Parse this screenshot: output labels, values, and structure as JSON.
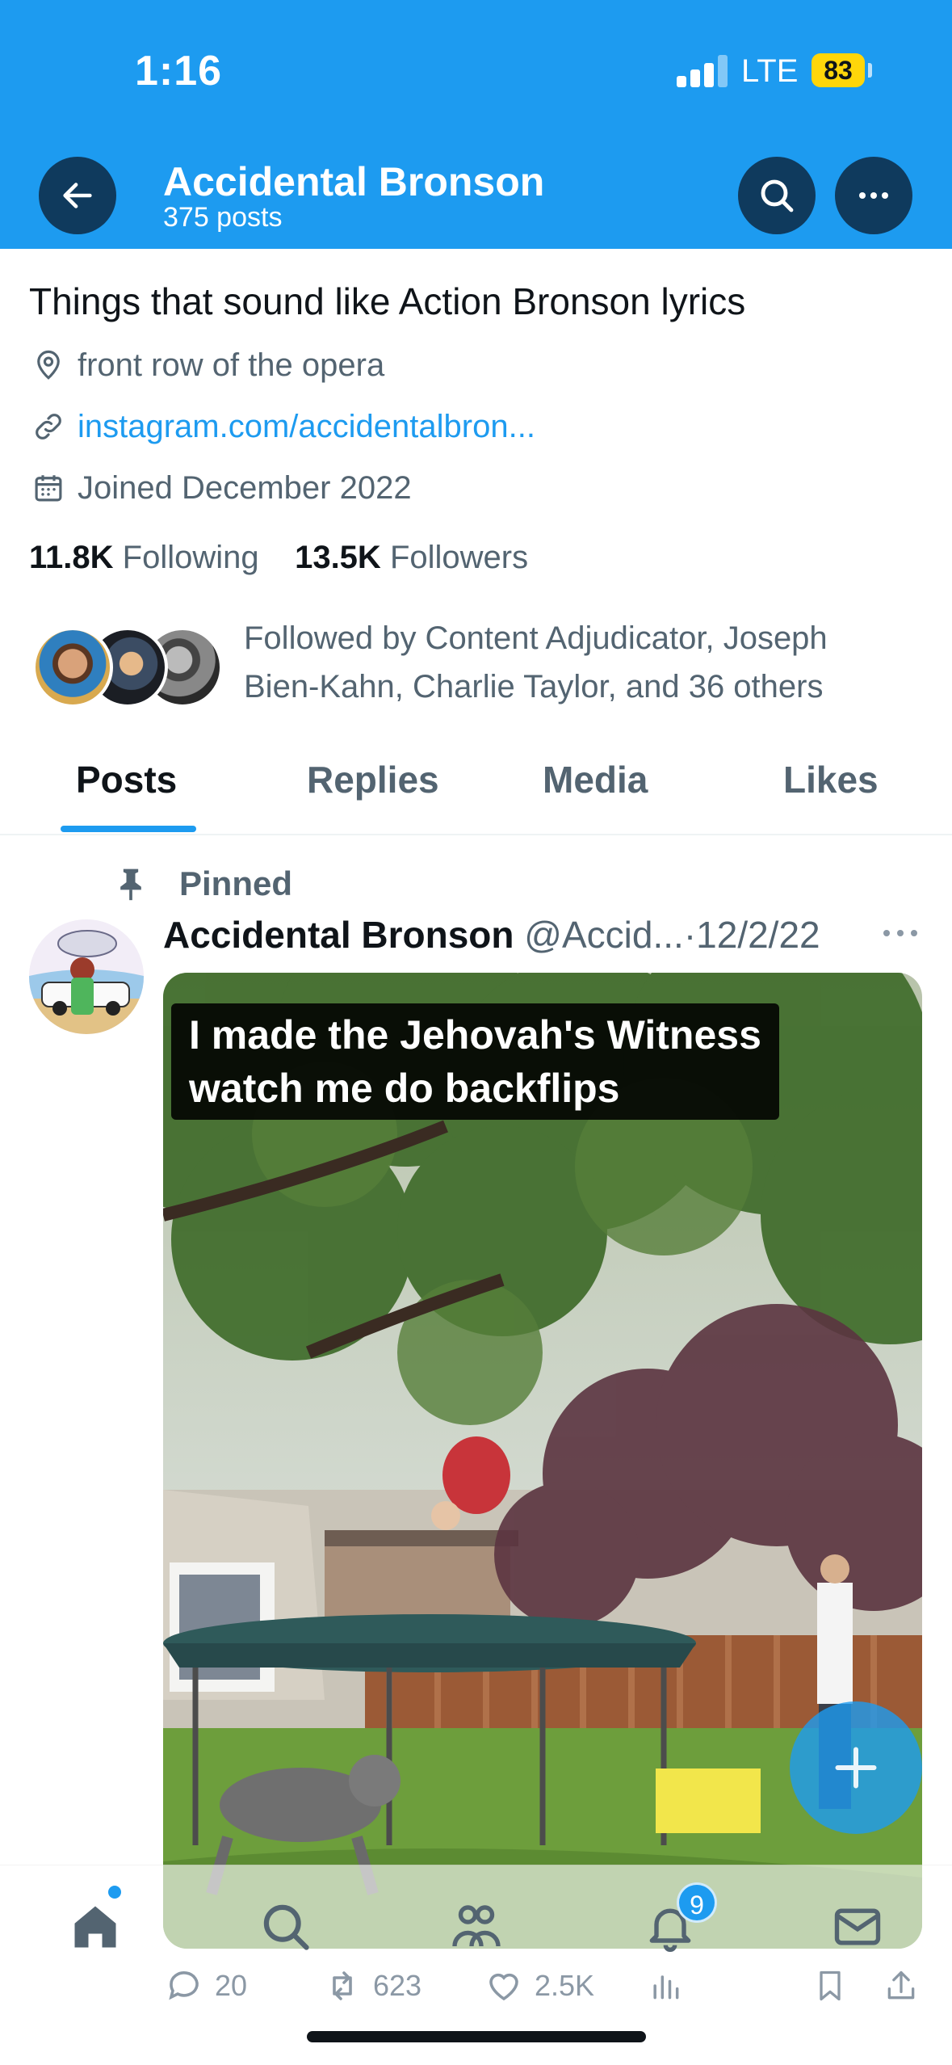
{
  "status_bar": {
    "time": "1:16",
    "network": "LTE",
    "battery": "83"
  },
  "header": {
    "title": "Accidental Bronson",
    "subtitle": "375 posts"
  },
  "profile": {
    "bio": "Things that sound like Action Bronson lyrics",
    "location": "front row of the opera",
    "link": "instagram.com/accidentalbron...",
    "joined": "Joined December 2022",
    "following_count": "11.8K",
    "following_label": "Following",
    "followers_count": "13.5K",
    "followers_label": "Followers",
    "followed_by": "Followed by Content Adjudicator, Joseph Bien-Kahn, Charlie Taylor, and 36 others"
  },
  "tabs": [
    {
      "label": "Posts",
      "active": true
    },
    {
      "label": "Replies",
      "active": false
    },
    {
      "label": "Media",
      "active": false
    },
    {
      "label": "Likes",
      "active": false
    }
  ],
  "post": {
    "pinned_label": "Pinned",
    "author_name": "Accidental Bronson",
    "handle": "@Accid...",
    "separator": "·",
    "date": "12/2/22",
    "media_caption_line1": "I made the Jehovah's Witness",
    "media_caption_line2": "watch me do backflips",
    "replies": "20",
    "reposts": "623",
    "likes": "2.5K"
  },
  "bottom_nav": {
    "items": [
      "home-icon",
      "search-icon",
      "communities-icon",
      "notifications-icon",
      "messages-icon"
    ],
    "notifications_badge": "9"
  },
  "colors": {
    "accent": "#1d9bf0",
    "header_button": "#0f3a5d",
    "battery": "#ffd60a"
  }
}
